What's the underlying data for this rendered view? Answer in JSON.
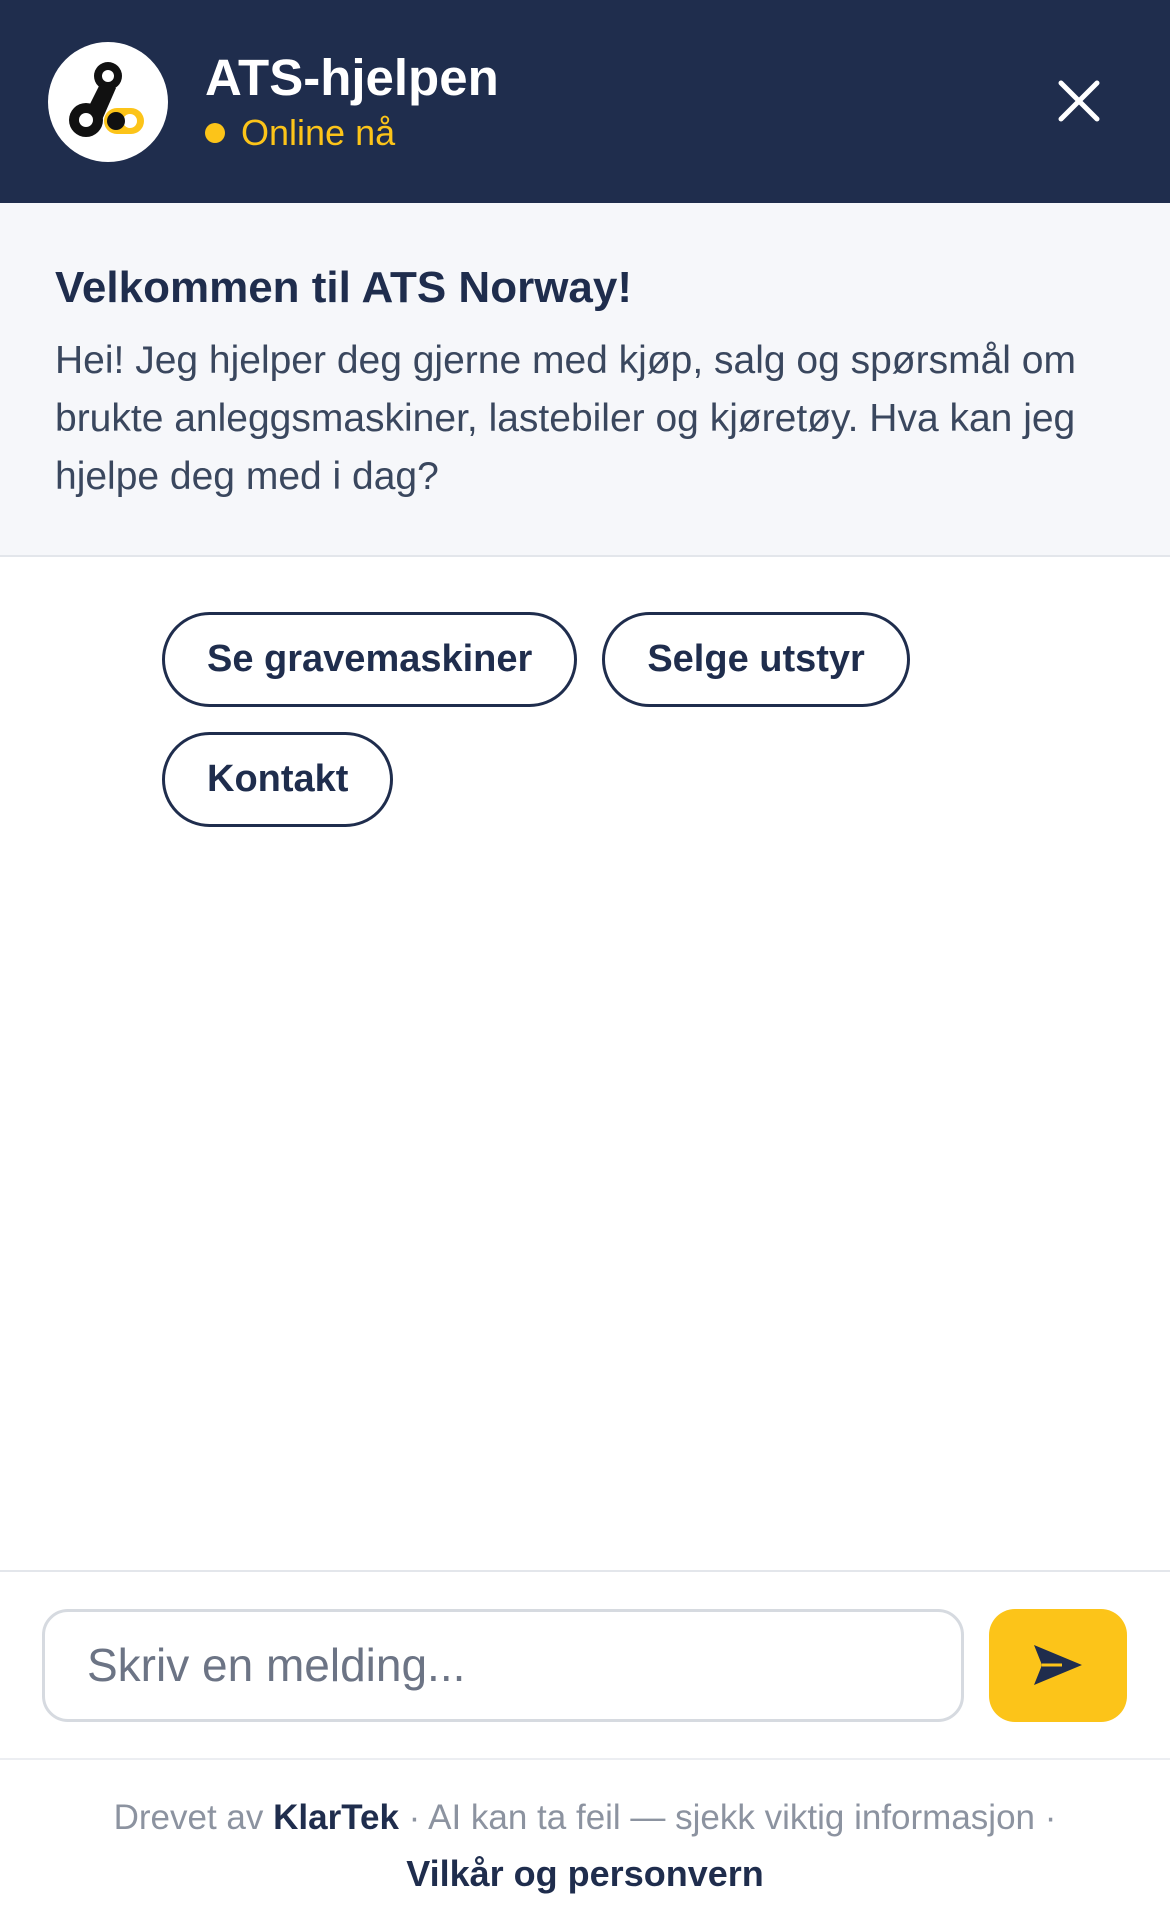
{
  "header": {
    "bot_name": "ATS-hjelpen",
    "status": "Online nå",
    "avatar_icon": "ats-logo-icon",
    "close_icon": "close-icon"
  },
  "welcome": {
    "title": "Velkommen til ATS Norway!",
    "body": "Hei! Jeg hjelper deg gjerne med kjøp, salg og spørsmål om brukte anleggsmaskiner, lastebiler og kjøretøy. Hva kan jeg hjelpe deg med i dag?"
  },
  "quick_replies": [
    {
      "label": "Se gravemaskiner"
    },
    {
      "label": "Selge utstyr"
    },
    {
      "label": "Kontakt"
    }
  ],
  "composer": {
    "placeholder": "Skriv en melding...",
    "send_icon": "send-icon"
  },
  "footer": {
    "powered_prefix": "Drevet av",
    "brand": "KlarTek",
    "disclaimer": "· AI kan ta feil — sjekk viktig informasjon ·",
    "terms_link": "Vilkår og personvern"
  },
  "colors": {
    "navy": "#1f2d4d",
    "accent_yellow": "#fcc419",
    "welcome_bg": "#f6f7fa"
  }
}
